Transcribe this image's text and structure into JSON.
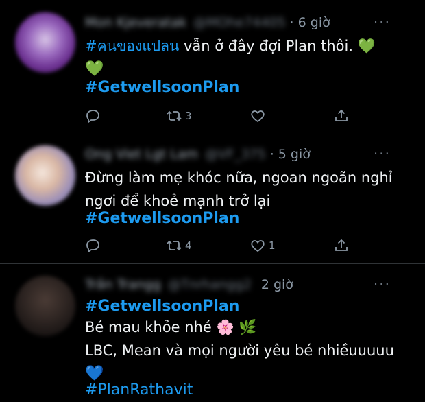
{
  "tweets": [
    {
      "display_name": "Mon Kjeveratak",
      "handle": "@MOhe74405",
      "time": "· 6 giờ",
      "more": "···",
      "text_hashtag": "#คนของแปลน",
      "text": " vẫn ở đây đợi Plan thôi. 💚",
      "text_line2": "💚",
      "hashtag": "#GetwellsoonPlan",
      "replies": "",
      "retweets": "3",
      "likes": "",
      "avatar_colors": [
        "#d7c4e6",
        "#9b6bbf",
        "#6a2f8f"
      ]
    },
    {
      "display_name": "Ong Viet Lgt Lam",
      "handle": "@VF_375",
      "time": "· 5 giờ",
      "more": "···",
      "text_line1": "Đừng làm mẹ khóc nữa, ngoan ngoãn nghỉ",
      "text_line2": "ngơi để khoẻ mạnh trở lại",
      "hashtag": "#GetwellsoonPlan",
      "replies": "",
      "retweets": "4",
      "likes": "1",
      "avatar_colors": [
        "#f4e6dc",
        "#d9b7a4",
        "#9c8fb8"
      ]
    },
    {
      "display_name": "Trần Trangg",
      "handle": "@Tnrhangg2",
      "time": "2 giờ",
      "more": "···",
      "hashtag": "#GetwellsoonPlan",
      "text_line1": "Bé mau khỏe nhé 🌸 🌿",
      "text_line2": "LBC, Mean và mọi người yêu bé nhiềuuuuu",
      "text_line3": "💙",
      "hashtag2": "#PlanRathavit",
      "avatar_colors": [
        "#4a3b35",
        "#2e2522",
        "#1a1514"
      ]
    }
  ],
  "colors": {
    "background": "#000000",
    "link": "#1d9bf0",
    "muted": "#8b98a5",
    "divider": "#2f3336"
  },
  "icons": [
    "reply-icon",
    "retweet-icon",
    "like-icon",
    "share-icon",
    "more-icon"
  ]
}
